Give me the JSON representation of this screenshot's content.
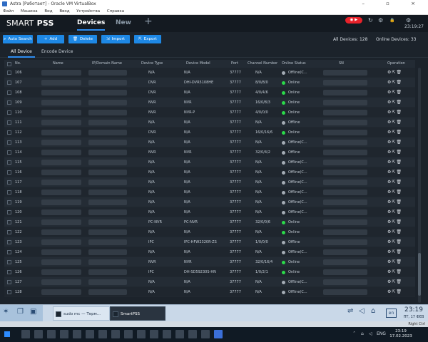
{
  "vbox": {
    "title": "Astra [Работает] - Oracle VM VirtualBox",
    "window_buttons": "– ▫ ×",
    "menu": [
      "Файл",
      "Машина",
      "Вид",
      "Ввод",
      "Устройства",
      "Справка"
    ]
  },
  "app": {
    "logo_bold": "SMART",
    "logo_thin": "PSS",
    "tabs": [
      "Devices",
      "New"
    ],
    "add_tab": "+",
    "rec_label": "◉ ▶",
    "time": "23:19:27",
    "top_icons": [
      "↻",
      "⚙",
      "🔒",
      "⚙",
      "–",
      "▫",
      "×"
    ]
  },
  "toolbar": {
    "auto_search": "Auto Search",
    "add": "Add",
    "delete": "Delete",
    "import": "Import",
    "export": "Export",
    "all_devices_label": "All Devices:",
    "all_devices_count": "128",
    "online_devices_label": "Online Devices:",
    "online_devices_count": "33"
  },
  "subtabs": [
    "All Device",
    "Encode Device"
  ],
  "table": {
    "headers": [
      "No.",
      "Name",
      "IP/Domain Name",
      "Device Type",
      "Device Model",
      "Port",
      "Channel Number",
      "Online Status",
      "SN",
      "Operation"
    ],
    "rows": [
      {
        "no": "106",
        "type": "N/A",
        "model": "N/A",
        "port": "37777",
        "channel": "N/A",
        "status": "Offline(C...",
        "online": false
      },
      {
        "no": "107",
        "type": "DVR",
        "model": "DHI-DVR5108HE",
        "port": "37777",
        "channel": "8/0/8/0",
        "status": "Online",
        "online": true
      },
      {
        "no": "108",
        "type": "DVR",
        "model": "N/A",
        "port": "37777",
        "channel": "4/0/4/6",
        "status": "Online",
        "online": true
      },
      {
        "no": "109",
        "type": "NVR",
        "model": "NVR",
        "port": "37777",
        "channel": "16/0/8/3",
        "status": "Online",
        "online": true
      },
      {
        "no": "110",
        "type": "NVR",
        "model": "NVR-P",
        "port": "37777",
        "channel": "4/0/0/0",
        "status": "Online",
        "online": true
      },
      {
        "no": "111",
        "type": "N/A",
        "model": "N/A",
        "port": "37777",
        "channel": "N/A",
        "status": "Offline",
        "online": false
      },
      {
        "no": "112",
        "type": "DVR",
        "model": "N/A",
        "port": "37777",
        "channel": "16/0/16/6",
        "status": "Online",
        "online": true
      },
      {
        "no": "113",
        "type": "N/A",
        "model": "N/A",
        "port": "37777",
        "channel": "N/A",
        "status": "Offline(C...",
        "online": false
      },
      {
        "no": "114",
        "type": "NVR",
        "model": "NVR",
        "port": "37777",
        "channel": "32/0/4/2",
        "status": "Offline",
        "online": false
      },
      {
        "no": "115",
        "type": "N/A",
        "model": "N/A",
        "port": "37777",
        "channel": "N/A",
        "status": "Offline(C...",
        "online": false
      },
      {
        "no": "116",
        "type": "N/A",
        "model": "N/A",
        "port": "37777",
        "channel": "N/A",
        "status": "Offline(C...",
        "online": false
      },
      {
        "no": "117",
        "type": "N/A",
        "model": "N/A",
        "port": "37777",
        "channel": "N/A",
        "status": "Offline(C...",
        "online": false
      },
      {
        "no": "118",
        "type": "N/A",
        "model": "N/A",
        "port": "37777",
        "channel": "N/A",
        "status": "Offline(C...",
        "online": false
      },
      {
        "no": "119",
        "type": "N/A",
        "model": "N/A",
        "port": "37777",
        "channel": "N/A",
        "status": "Offline(C...",
        "online": false
      },
      {
        "no": "120",
        "type": "N/A",
        "model": "N/A",
        "port": "37777",
        "channel": "N/A",
        "status": "Offline(C...",
        "online": false
      },
      {
        "no": "121",
        "type": "PC-NVR",
        "model": "PC-NVR",
        "port": "37777",
        "channel": "32/0/0/6",
        "status": "Online",
        "online": true
      },
      {
        "no": "122",
        "type": "N/A",
        "model": "N/A",
        "port": "37777",
        "channel": "N/A",
        "status": "Online",
        "online": true
      },
      {
        "no": "123",
        "type": "IPC",
        "model": "IPC-HFW2320R-ZS",
        "port": "37777",
        "channel": "1/0/0/0",
        "status": "Offline",
        "online": false
      },
      {
        "no": "124",
        "type": "N/A",
        "model": "N/A",
        "port": "37777",
        "channel": "N/A",
        "status": "Offline(C...",
        "online": false
      },
      {
        "no": "125",
        "type": "NVR",
        "model": "NVR",
        "port": "37777",
        "channel": "32/0/16/4",
        "status": "Online",
        "online": true
      },
      {
        "no": "126",
        "type": "IPC",
        "model": "DH-SD59230S-HN",
        "port": "37777",
        "channel": "1/0/2/1",
        "status": "Online",
        "online": true
      },
      {
        "no": "127",
        "type": "N/A",
        "model": "N/A",
        "port": "37777",
        "channel": "N/A",
        "status": "Offline(C...",
        "online": false
      },
      {
        "no": "128",
        "type": "N/A",
        "model": "N/A",
        "port": "37777",
        "channel": "N/A",
        "status": "Offline(C...",
        "online": false
      }
    ]
  },
  "vm_taskbar": {
    "task1": "sudo mc — Терм...",
    "task2": "SmartPSS",
    "lang": "en",
    "time": "23:19",
    "date": "ПТ, 17 ФЕВ"
  },
  "host": {
    "lang": "ENG",
    "time": "23:19",
    "date": "17.02.2023",
    "right_ctrl": "Right Ctrl"
  },
  "colors": {
    "accent": "#1e88e5",
    "online": "#2bd94a",
    "offline": "#a4acb5",
    "rec": "#e8222a"
  }
}
